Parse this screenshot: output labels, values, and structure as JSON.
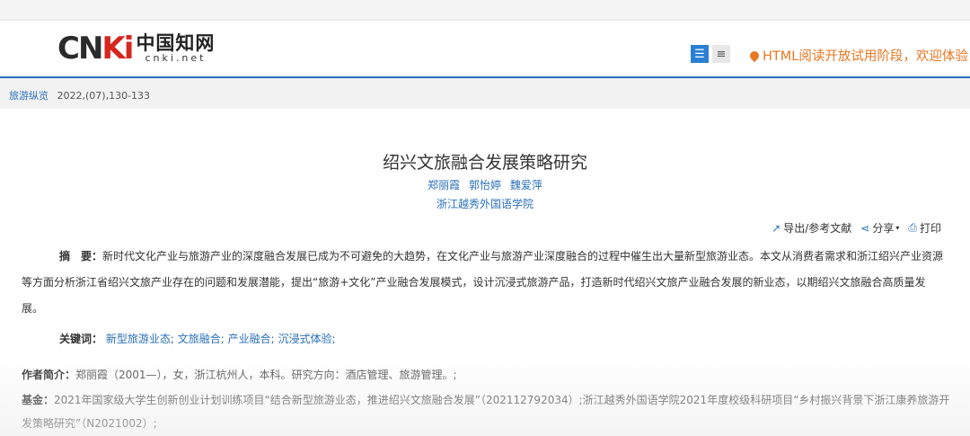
{
  "header": {
    "logo": {
      "mark_prefix": "CN",
      "mark_suffix": "Ki",
      "cn_name": "中国知网",
      "domain": "cnki.net"
    },
    "view_icons": [
      "list-view-icon",
      "outline-view-icon"
    ],
    "notice": "HTML阅读开放试用阶段，欢迎体验！"
  },
  "breadcrumb": {
    "journal": "旅游纵览",
    "issue": "2022,(07),130-133"
  },
  "article": {
    "title": "绍兴文旅融合发展策略研究",
    "authors": [
      "郑丽霞",
      "郭怡婷",
      "魏爱萍"
    ],
    "affiliation": "浙江越秀外国语学院"
  },
  "tools": {
    "export": "导出/参考文献",
    "share": "分享",
    "print": "打印"
  },
  "abstract": {
    "label": "摘　要：",
    "text": "新时代文化产业与旅游产业的深度融合发展已成为不可避免的大趋势，在文化产业与旅游产业深度融合的过程中催生出大量新型旅游业态。本文从消费者需求和浙江绍兴产业资源等方面分析浙江省绍兴文旅产业存在的问题和发展潜能，提出“旅游+文化”产业融合发展模式，设计沉浸式旅游产品，打造新时代绍兴文旅产业融合发展的新业态，以期绍兴文旅融合高质量发展。"
  },
  "keywords": {
    "label": "关键词：",
    "items": [
      "新型旅游业态;",
      "文旅融合;",
      "产业融合;",
      "沉浸式体验;"
    ]
  },
  "author_intro": {
    "label": "作者简介：",
    "text": "郑丽霞（2001—），女，浙江杭州人，本科。研究方向：酒店管理、旅游管理。;"
  },
  "fund": {
    "label": "基金：",
    "text": "2021年国家级大学生创新创业计划训练项目“结合新型旅游业态，推进绍兴文旅融合发展”（202112792034）;浙江越秀外国语学院2021年度校级科研项目“乡村振兴背景下浙江康养旅游开发策略研究”（N2021002）;"
  },
  "colors": {
    "link": "#2a6fb9",
    "notice": "#e87722",
    "accent_bar": "#2a7fd4"
  }
}
